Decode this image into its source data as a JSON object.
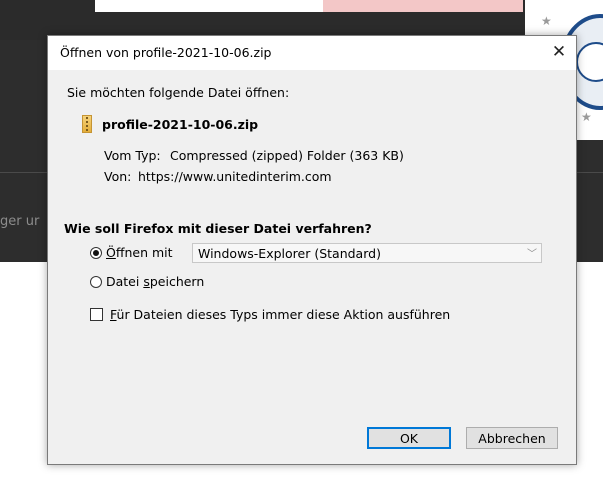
{
  "dialog": {
    "title": "Öffnen von profile-2021-10-06.zip",
    "intro": "Sie möchten folgende Datei öffnen:",
    "filename": "profile-2021-10-06.zip",
    "type_label": "Vom Typ:",
    "type_value": "Compressed (zipped) Folder (363 KB)",
    "from_label": "Von:",
    "from_value": "https://www.unitedinterim.com",
    "question": "Wie soll Firefox mit dieser Datei verfahren?",
    "open_with_first": "Ö",
    "open_with_rest": "ffnen mit",
    "open_with_app": "Windows-Explorer (Standard)",
    "save_pre": "Datei ",
    "save_ul": "s",
    "save_post": "peichern",
    "always_ul": "F",
    "always_rest": "ür Dateien dieses Typs immer diese Aktion ausführen",
    "ok_label": "OK",
    "cancel_label": "Abbrechen"
  },
  "background": {
    "side_text": "ger ur"
  },
  "icons": {
    "close": "close-icon",
    "zip": "zip-file-icon",
    "chevron": "chevron-down-icon"
  },
  "colors": {
    "default_button_border": "#0078d7",
    "dialog_bg": "#f0f0f0",
    "page_dark": "#2d2d2d"
  }
}
